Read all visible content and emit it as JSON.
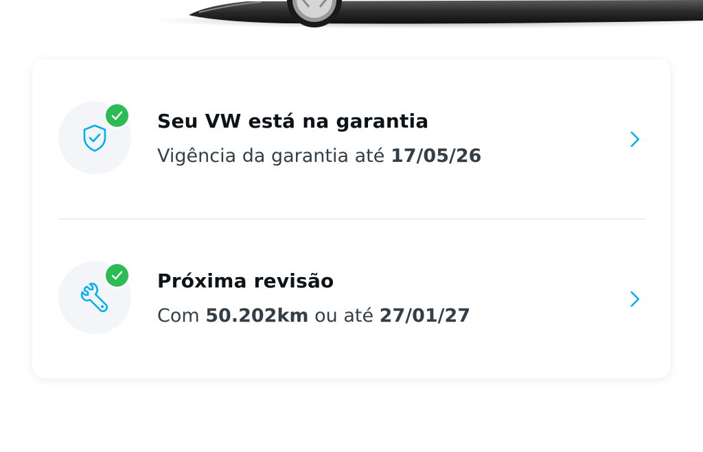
{
  "colors": {
    "accent": "#00b0f0",
    "check_green": "#2dbb55",
    "title_text": "#0d1216",
    "subtitle_text": "#333f48",
    "icon_bg": "#f3f5f8"
  },
  "warranty": {
    "icon": "shield-check-icon",
    "title": "Seu VW está na garantia",
    "subtitle_prefix": "Vigência da garantia até ",
    "date": "17/05/26"
  },
  "revision": {
    "icon": "wrench-icon",
    "title": "Próxima revisão",
    "subtitle_prefix": "Com ",
    "km": "50.202km",
    "subtitle_middle": " ou até ",
    "date": "27/01/27"
  }
}
